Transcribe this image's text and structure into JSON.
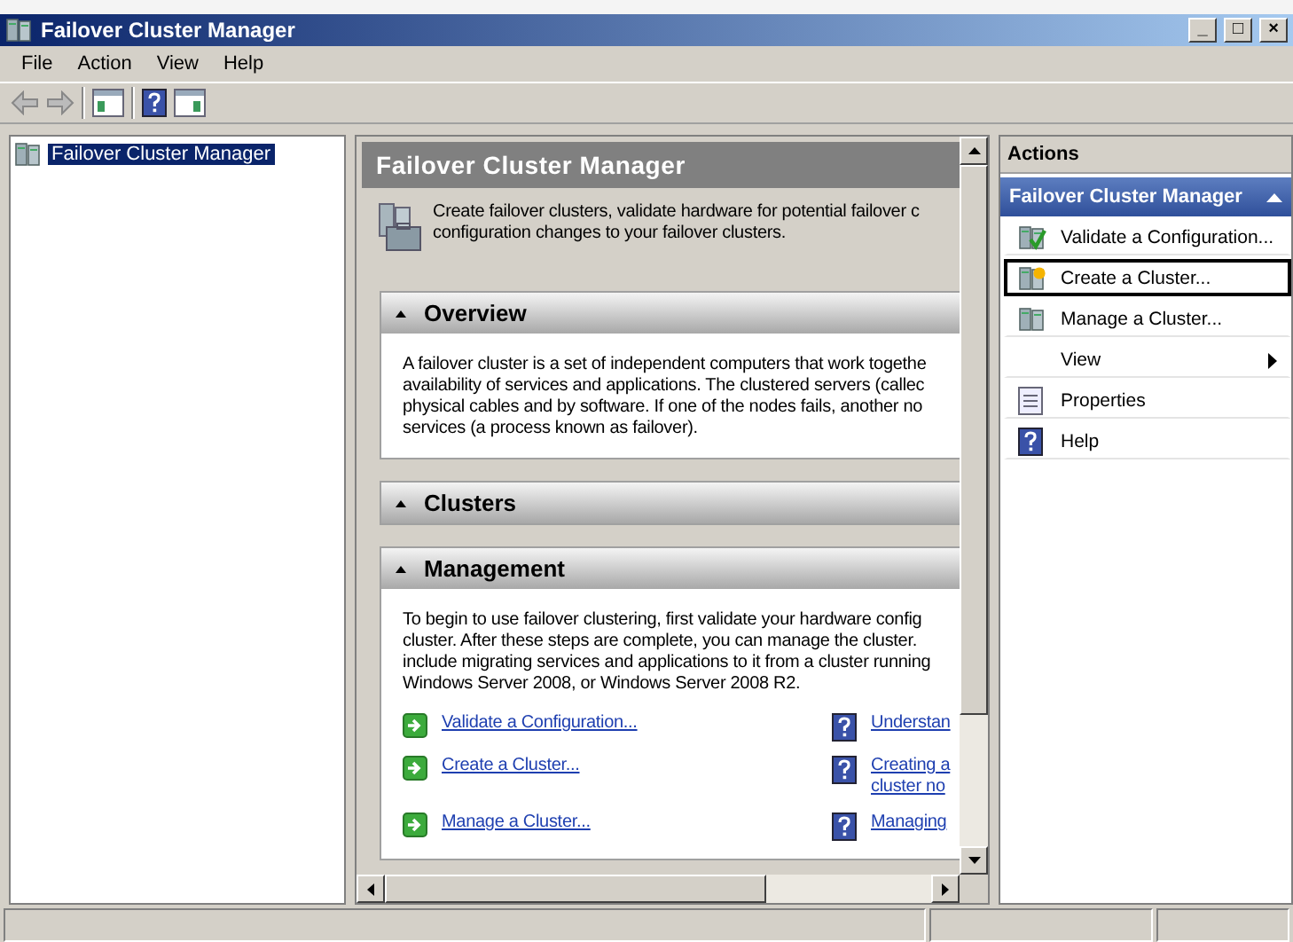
{
  "window": {
    "title": "Failover Cluster Manager",
    "controls": [
      "_",
      "□",
      "×"
    ]
  },
  "menu": [
    "File",
    "Action",
    "View",
    "Help"
  ],
  "tree": [
    {
      "label": "Failover Cluster Manager",
      "selected": true
    }
  ],
  "center": {
    "title": "Failover Cluster Manager",
    "intro": [
      "Create failover clusters, validate hardware for potential failover c",
      "configuration changes to your failover clusters."
    ],
    "sections": [
      {
        "title": "Overview",
        "expanded": true,
        "lines": [
          "A failover cluster is a set of independent computers that work togethe",
          "availability of services and applications. The clustered servers (callec",
          "physical cables and by software. If one of the nodes fails, another no",
          "services (a process known as failover)."
        ]
      },
      {
        "title": "Clusters",
        "expanded": true
      },
      {
        "title": "Management",
        "expanded": true,
        "lines": [
          "To begin to use failover clustering, first validate your hardware config",
          "cluster.  After these steps are complete, you can manage the cluster.",
          "include migrating services and applications to it from a cluster running",
          "Windows Server 2008, or Windows Server 2008 R2."
        ],
        "tasks": [
          {
            "label": "Validate a Configuration...",
            "help": [
              "Understan"
            ]
          },
          {
            "label": "Create a Cluster...",
            "help": [
              "Creating a",
              "cluster no"
            ]
          },
          {
            "label": "Manage a Cluster...",
            "help": [
              "Managing"
            ]
          }
        ]
      }
    ]
  },
  "actions": {
    "title": "Actions",
    "group": "Failover Cluster Manager",
    "items": [
      {
        "label": "Validate a Configuration...",
        "kind": "command",
        "selected": false
      },
      {
        "label": "Create a Cluster...",
        "kind": "command",
        "selected": true
      },
      {
        "label": "Manage a Cluster...",
        "kind": "command",
        "selected": false
      },
      {
        "label": "View",
        "kind": "submenu",
        "selected": false
      },
      {
        "label": "Properties",
        "kind": "command",
        "selected": false
      },
      {
        "label": "Help",
        "kind": "command",
        "selected": false
      }
    ]
  }
}
